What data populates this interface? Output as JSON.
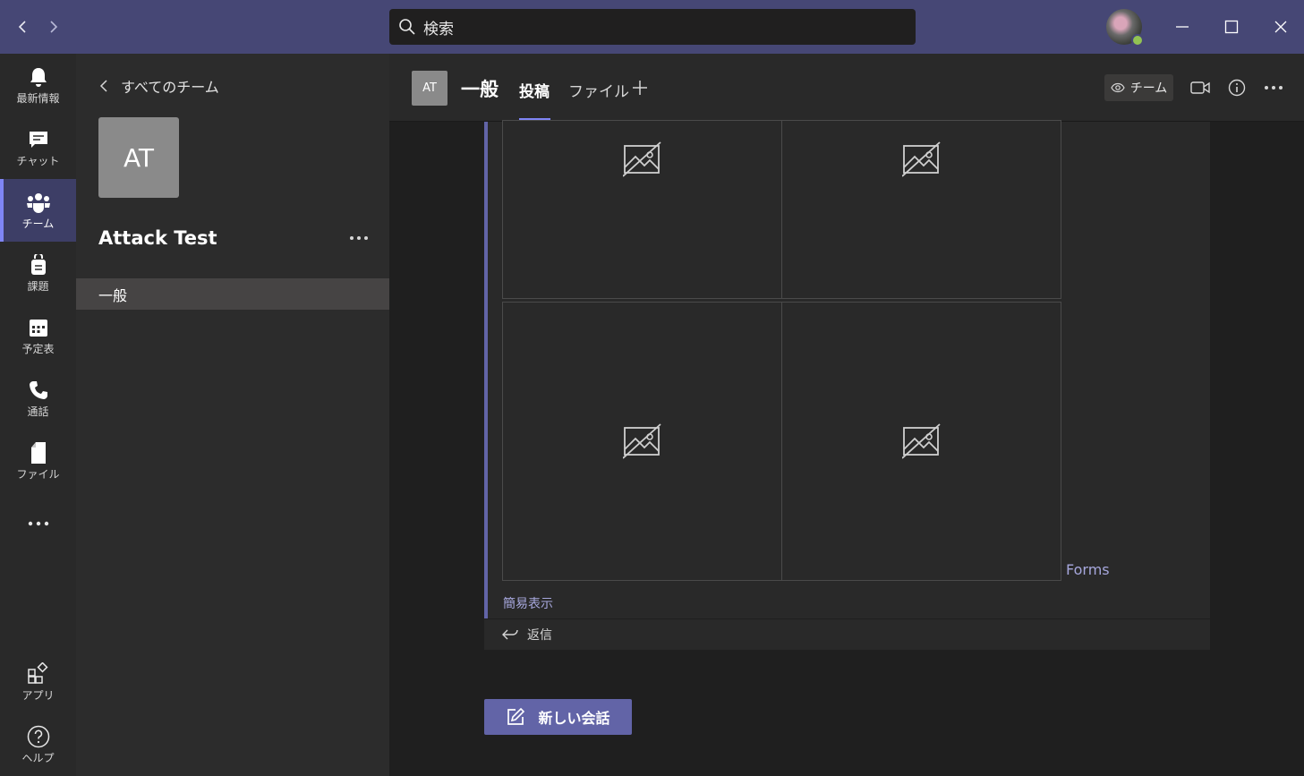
{
  "titlebar": {
    "search_placeholder": "検索"
  },
  "rail": {
    "items": [
      {
        "label": "最新情報",
        "icon": "bell-icon"
      },
      {
        "label": "チャット",
        "icon": "chat-icon"
      },
      {
        "label": "チーム",
        "icon": "teams-icon"
      },
      {
        "label": "課題",
        "icon": "assignments-icon"
      },
      {
        "label": "予定表",
        "icon": "calendar-icon"
      },
      {
        "label": "通話",
        "icon": "phone-icon"
      },
      {
        "label": "ファイル",
        "icon": "file-icon"
      }
    ],
    "apps_label": "アプリ",
    "help_label": "ヘルプ"
  },
  "teampanel": {
    "back_label": "すべてのチーム",
    "team_initials": "AT",
    "team_name": "Attack Test",
    "channels": [
      "一般"
    ]
  },
  "header": {
    "channel_initials": "AT",
    "channel_name": "一般",
    "tabs": [
      "投稿",
      "ファイル"
    ],
    "active_tab": "投稿",
    "team_button_label": "チーム"
  },
  "message": {
    "forms_label": "Forms",
    "simple_view_label": "簡易表示",
    "reply_label": "返信"
  },
  "new_conversation_label": "新しい会話",
  "colors": {
    "titlebar": "#464775",
    "accent": "#6264a7",
    "link": "#a6a7dc"
  }
}
